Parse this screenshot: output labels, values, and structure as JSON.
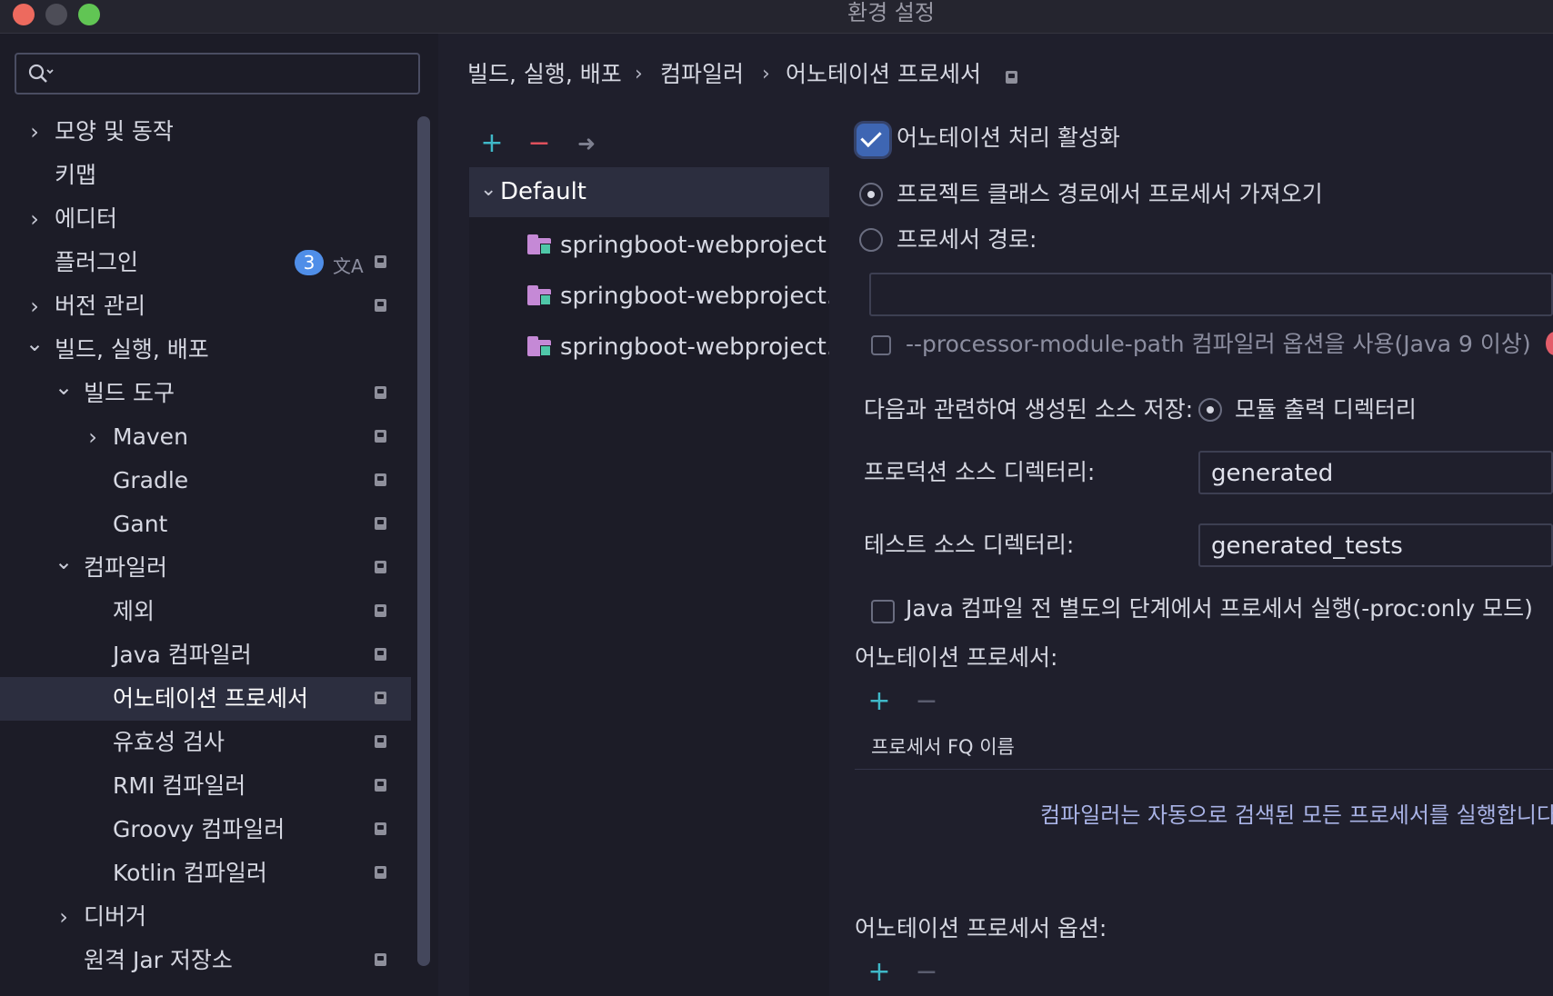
{
  "window": {
    "title": "환경 설정"
  },
  "sidebar": {
    "search_placeholder": "",
    "items": [
      {
        "label": "모양 및 동작",
        "expander": "collapsed"
      },
      {
        "label": "키맵"
      },
      {
        "label": "에디터",
        "expander": "collapsed"
      },
      {
        "label": "플러그인",
        "badge": "3"
      },
      {
        "label": "버전 관리",
        "expander": "collapsed"
      },
      {
        "label": "빌드, 실행, 배포",
        "expander": "expanded"
      },
      {
        "label": "빌드 도구",
        "expander": "expanded"
      },
      {
        "label": "Maven",
        "expander": "collapsed"
      },
      {
        "label": "Gradle"
      },
      {
        "label": "Gant"
      },
      {
        "label": "컴파일러",
        "expander": "expanded"
      },
      {
        "label": "제외"
      },
      {
        "label": "Java 컴파일러"
      },
      {
        "label": "어노테이션 프로세서",
        "selected": true
      },
      {
        "label": "유효성 검사"
      },
      {
        "label": "RMI 컴파일러"
      },
      {
        "label": "Groovy 컴파일러"
      },
      {
        "label": "Kotlin 컴파일러"
      },
      {
        "label": "디버거",
        "expander": "collapsed"
      },
      {
        "label": "원격 Jar 저장소"
      }
    ]
  },
  "breadcrumb": [
    "빌드, 실행, 배포",
    "컴파일러",
    "어노테이션 프로세서"
  ],
  "profiles": {
    "toolbar": {
      "add": "+",
      "remove": "−",
      "move": "➜"
    },
    "default_label": "Default",
    "modules": [
      "springboot-webproject",
      "springboot-webproject.main",
      "springboot-webproject.test"
    ]
  },
  "settings": {
    "enable_label": "어노테이션 처리 활성화",
    "enable_checked": true,
    "radio_classpath": "프로젝트 클래스 경로에서 프로세서 가져오기",
    "radio_processor_path": "프로세서 경로:",
    "processor_path_value": "",
    "module_path_option": "--processor-module-path 컴파일러 옵션을 사용(Java 9 이상)",
    "store_label": "다음과 관련하여 생성된 소스 저장:",
    "store_option_module_output": "모듈 출력 디렉터리",
    "production_dir_label": "프로덕션 소스 디렉터리:",
    "production_dir_value": "generated",
    "test_dir_label": "테스트 소스 디렉터리:",
    "test_dir_value": "generated_tests",
    "proc_only_label": "Java 컴파일 전 별도의 단계에서 프로세서 실행(-proc:only 모드)",
    "processors_section": "어노테이션 프로세서:",
    "processors_column": "프로세서 FQ 이름",
    "processors_empty": "컴파일러는 자동으로 검색된 모든 프로세서를 실행합니다",
    "options_section": "어노테이션 프로세서 옵션:",
    "add": "+",
    "remove": "−"
  },
  "colors": {
    "accent": "#3e66b3",
    "add_green": "#3fb8c8",
    "remove_red": "#e0505c",
    "badge": "#4f8ee8"
  }
}
